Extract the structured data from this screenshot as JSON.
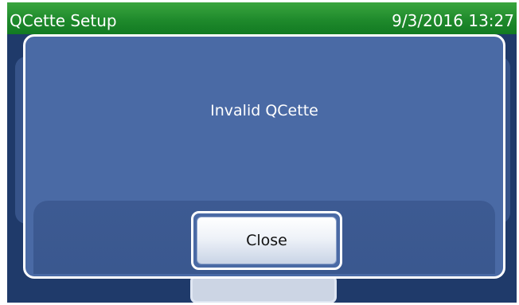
{
  "header": {
    "title": "QCette Setup",
    "datetime": "9/3/2016 13:27"
  },
  "dialog": {
    "message": "Invalid QCette",
    "close_label": "Close"
  },
  "colors": {
    "header_green": "#1f8a2c",
    "dialog_blue": "#4a6aa5",
    "screen_background": "#1f3a6a"
  }
}
